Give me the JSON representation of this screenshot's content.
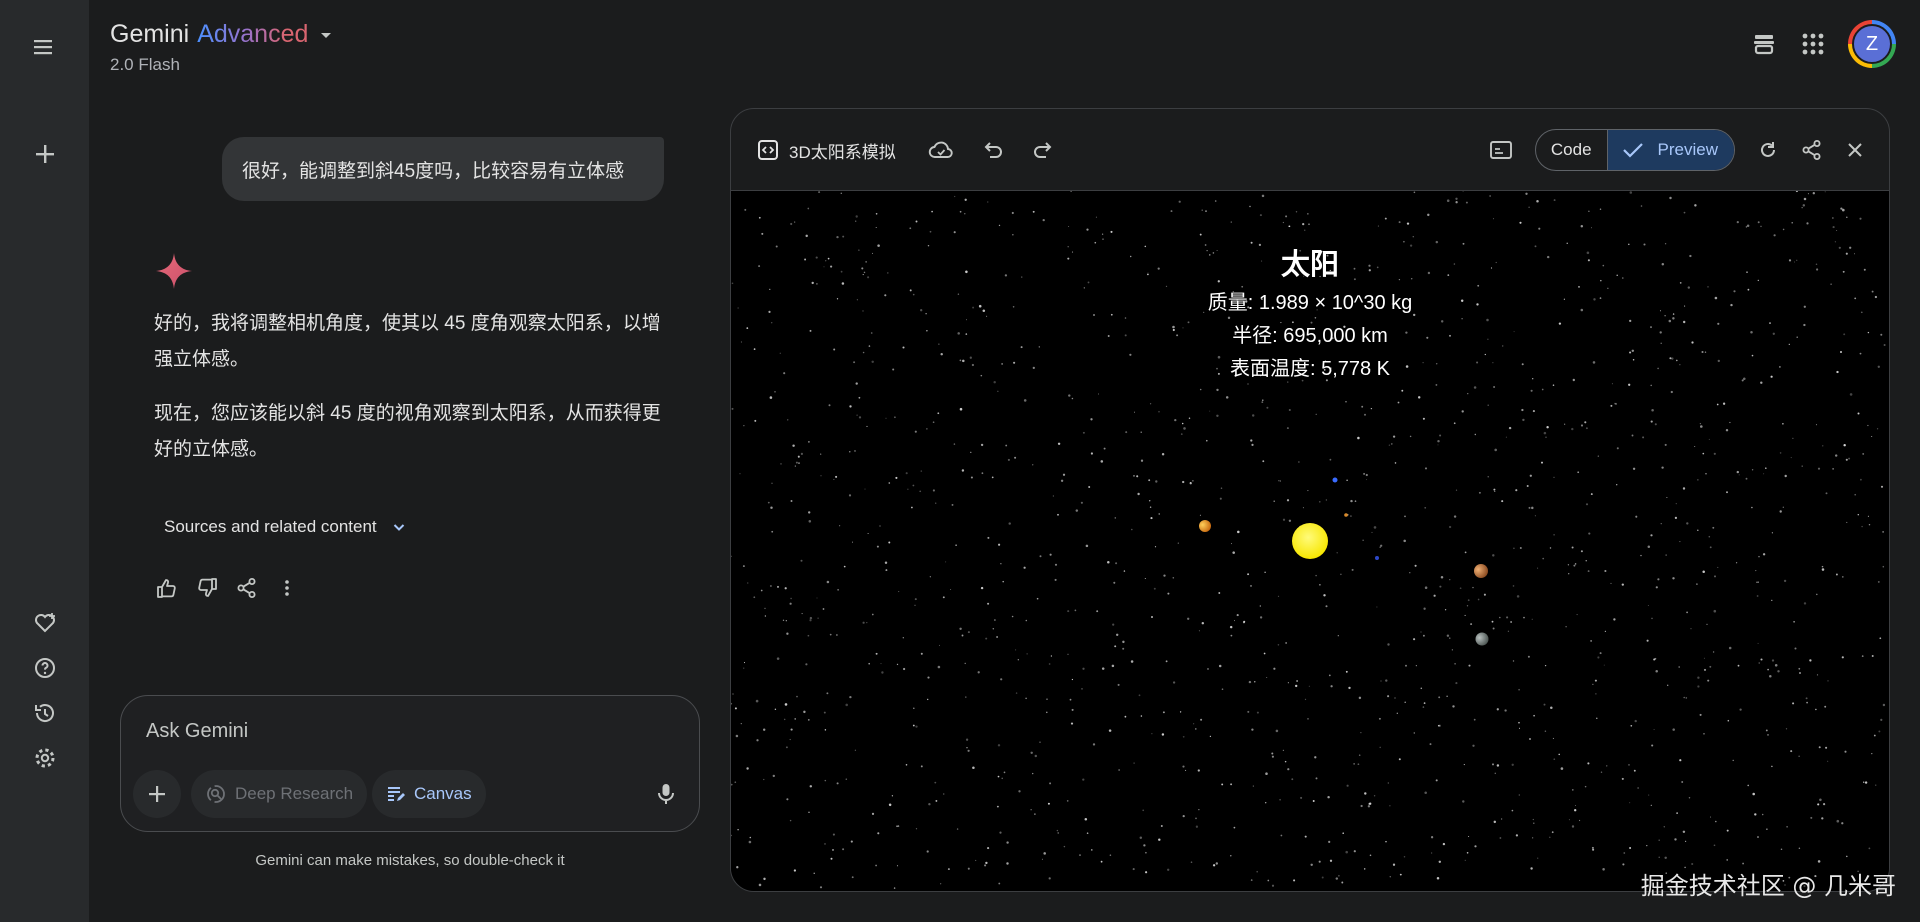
{
  "header": {
    "title_main": "Gemini",
    "title_tier": "Advanced",
    "model": "2.0 Flash",
    "avatar_letter": "Z"
  },
  "rail": {
    "icons": [
      "menu-icon",
      "new-chat-icon",
      "gem-manager-icon",
      "help-icon",
      "activity-icon",
      "settings-icon"
    ]
  },
  "chat": {
    "user_message": "很好，能调整到斜45度吗，比较容易有立体感",
    "reply_p1": "好的，我将调整相机角度，使其以 45 度角观察太阳系，以增强立体感。",
    "reply_p2": "现在，您应该能以斜 45 度的视角观察到太阳系，从而获得更好的立体感。",
    "sources_label": "Sources and related content"
  },
  "composer": {
    "placeholder": "Ask Gemini",
    "deep_research": "Deep Research",
    "canvas": "Canvas",
    "disclaimer": "Gemini can make mistakes, so double-check it"
  },
  "canvas": {
    "title": "3D太阳系模拟",
    "code_label": "Code",
    "preview_label": "Preview",
    "sun_info": {
      "name": "太阳",
      "mass": "质量: 1.989 × 10^30 kg",
      "radius": "半径: 695,000 km",
      "temperature": "表面温度: 5,778 K"
    }
  },
  "colors": {
    "accent": "#a8c7fa",
    "sun": "#fff200",
    "preview_bg": "#1e3a5f"
  },
  "watermark": "掘金技术社区 @ 几米哥"
}
